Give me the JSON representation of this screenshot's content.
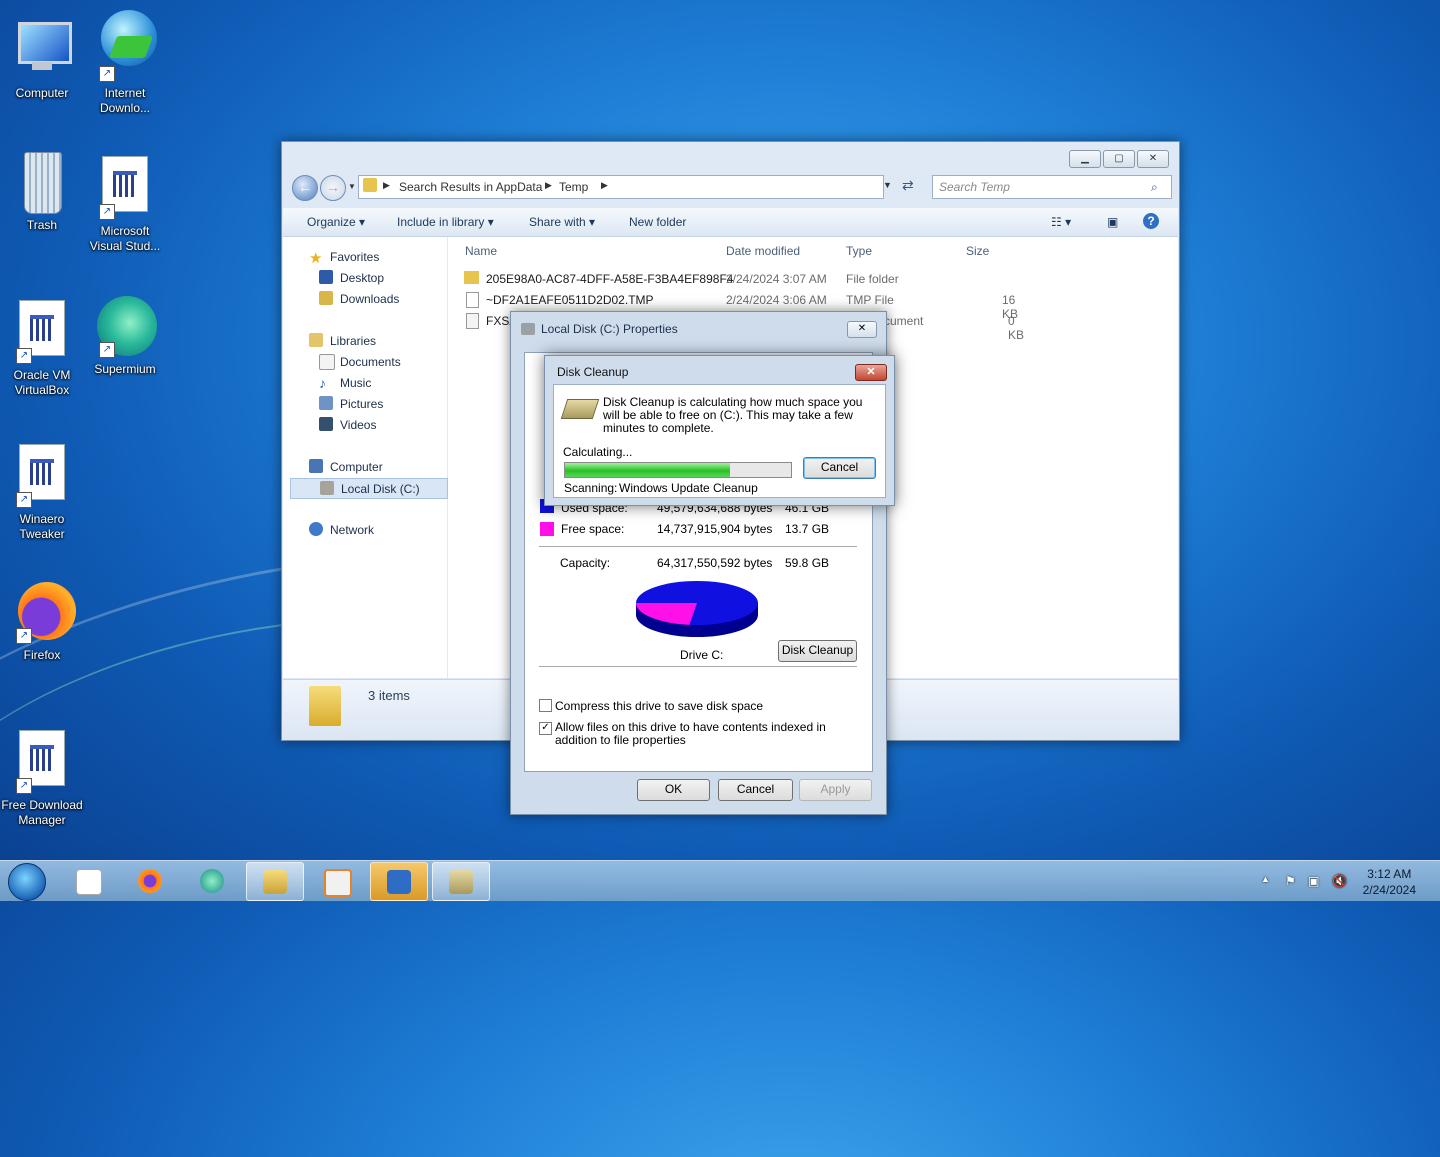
{
  "desktop": {
    "icons": [
      {
        "label": "Computer"
      },
      {
        "label": "Internet Downlo..."
      },
      {
        "label": "Trash"
      },
      {
        "label": "Microsoft Visual Stud..."
      },
      {
        "label": "Oracle VM VirtualBox"
      },
      {
        "label": "Supermium"
      },
      {
        "label": "Winaero Tweaker"
      },
      {
        "label": "Firefox"
      },
      {
        "label": "Free Download Manager"
      }
    ]
  },
  "explorer": {
    "breadcrumb": [
      "Search Results in AppData",
      "Temp"
    ],
    "search_placeholder": "Search Temp",
    "toolbar": {
      "organize": "Organize",
      "include": "Include in library",
      "share": "Share with",
      "new_folder": "New folder"
    },
    "nav": {
      "favorites": "Favorites",
      "desktop": "Desktop",
      "downloads": "Downloads",
      "libraries": "Libraries",
      "documents": "Documents",
      "music": "Music",
      "pictures": "Pictures",
      "videos": "Videos",
      "computer": "Computer",
      "local_disk": "Local Disk (C:)",
      "network": "Network"
    },
    "columns": {
      "name": "Name",
      "date": "Date modified",
      "type": "Type",
      "size": "Size"
    },
    "files": [
      {
        "name": "205E98A0-AC87-4DFF-A58E-F3BA4EF898F4",
        "date": "2/24/2024 3:07 AM",
        "type": "File folder",
        "size": ""
      },
      {
        "name": "~DF2A1EAFE0511D2D02.TMP",
        "date": "2/24/2024 3:06 AM",
        "type": "TMP File",
        "size": "16 KB"
      },
      {
        "name": "FXSA",
        "date": "",
        "type": "cument",
        "size": "0 KB"
      }
    ],
    "status_count": "3 items"
  },
  "properties": {
    "title": "Local Disk (C:) Properties",
    "used_label": "Used space:",
    "used_bytes": "49,579,634,688 bytes",
    "used_gb": "46.1 GB",
    "free_label": "Free space:",
    "free_bytes": "14,737,915,904 bytes",
    "free_gb": "13.7 GB",
    "capacity_label": "Capacity:",
    "capacity_bytes": "64,317,550,592 bytes",
    "capacity_gb": "59.8 GB",
    "used_fraction": 0.77,
    "used_color": "#1010e0",
    "free_color": "#ff10e8",
    "drive_label": "Drive C:",
    "disk_cleanup_button": "Disk Cleanup",
    "compress_label": "Compress this drive to save disk space",
    "compress_checked": false,
    "index_label": "Allow files on this drive to have contents indexed in addition to file properties",
    "index_checked": true,
    "ok": "OK",
    "cancel": "Cancel",
    "apply": "Apply"
  },
  "disk_cleanup": {
    "title": "Disk Cleanup",
    "message": "Disk Cleanup is calculating how much space you will be able to free on  (C:). This may take a few minutes to complete.",
    "calculating": "Calculating...",
    "progress": 0.73,
    "cancel": "Cancel",
    "scanning_label": "Scanning:",
    "scanning_item": "Windows Update Cleanup"
  },
  "taskbar": {
    "time": "3:12 AM",
    "date": "2/24/2024"
  }
}
